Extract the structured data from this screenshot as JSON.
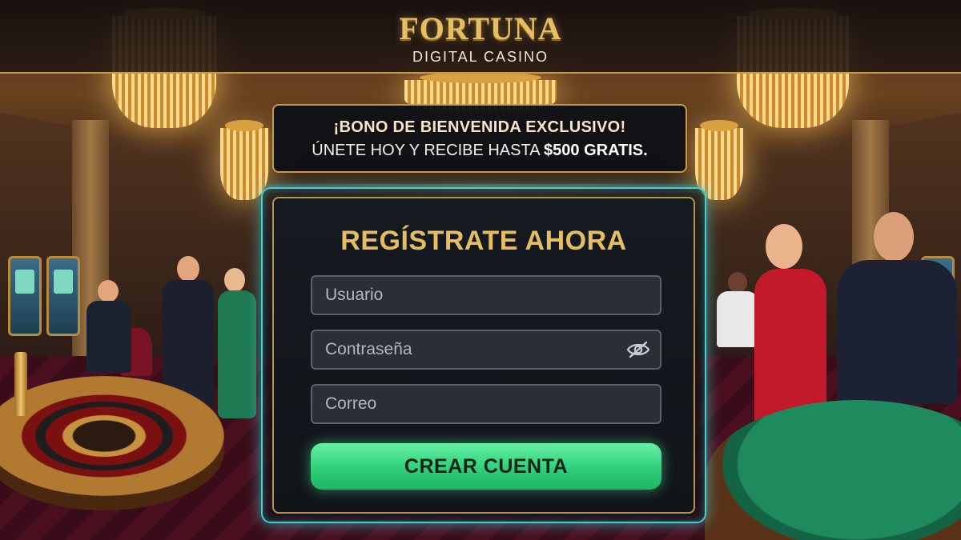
{
  "brand": {
    "name": "FORTUNA",
    "subtitle": "DIGITAL CASINO"
  },
  "promo": {
    "title": "¡BONO DE BIENVENIDA EXCLUSIVO!",
    "line_prefix": "ÚNETE HOY Y RECIBE HASTA ",
    "line_highlight": "$500 GRATIS."
  },
  "register": {
    "title": "REGÍSTRATE AHORA",
    "username_placeholder": "Usuario",
    "password_placeholder": "Contraseña",
    "email_placeholder": "Correo",
    "password_toggle_icon": "eye-slash-icon",
    "submit_label": "CREAR CUENTA"
  },
  "colors": {
    "gold": "#e7bd5f",
    "neon_border": "#3fd0d4",
    "button_green": "#2fcf7a"
  }
}
